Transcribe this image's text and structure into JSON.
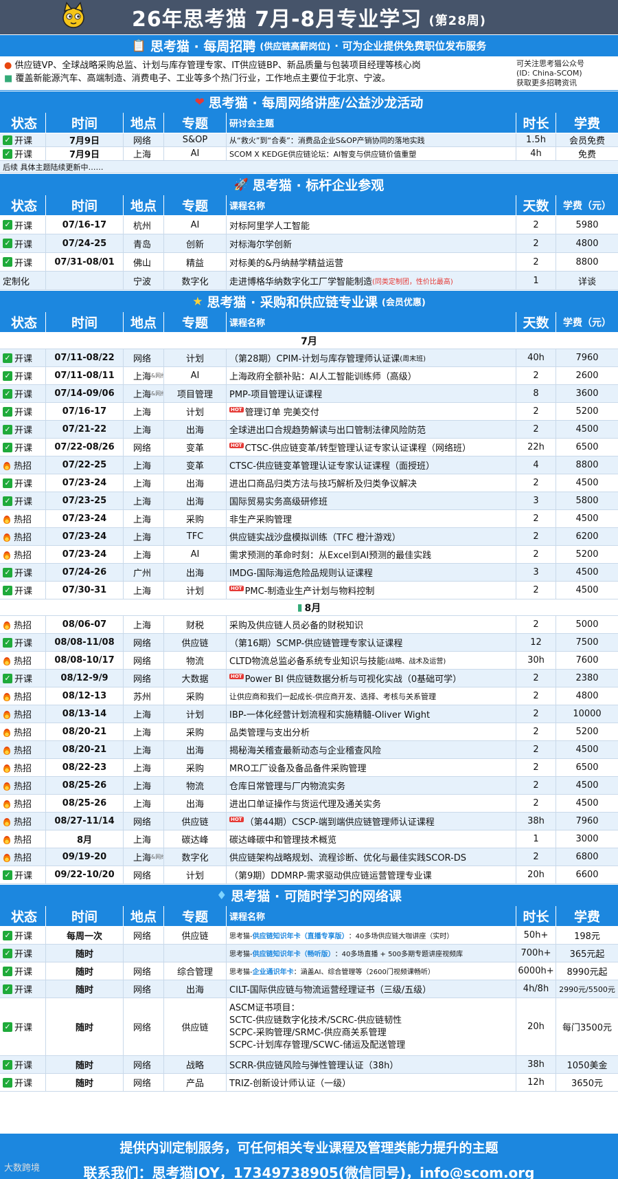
{
  "title": {
    "main": "26年思考猫 7月-8月专业学习",
    "week": "(第28周)"
  },
  "recruit": {
    "heading": "思考猫 · 每周招聘",
    "heading_sub": "(供应链高薪岗位)",
    "heading_tail": "· 可为企业提供免费职位发布服务",
    "line1": "供应链VP、全球战略采购总监、计划与库存管理专家、IT供应链BP、新品质量与包装项目经理等核心岗",
    "line2": "覆盖新能源汽车、高端制造、消费电子、工业等多个热门行业，工作地点主要位于北京、宁波。",
    "side1": "可关注思考猫公众号",
    "side2": "(ID: China-SCOM)",
    "side3": "获取更多招聘资讯"
  },
  "seminar": {
    "heading": "思考猫 · 每周网络讲座/公益沙龙活动",
    "headers": [
      "状态",
      "时间",
      "地点",
      "专题",
      "研讨会主题",
      "时长",
      "学费"
    ],
    "rows": [
      {
        "status": "开课",
        "time": "7月9日",
        "loc": "网络",
        "topic": "S&OP",
        "name": "从“救火”到“合奏”：消费品企业S&OP产销协同的落地实践",
        "dur": "1.5h",
        "fee": "会员免费"
      },
      {
        "status": "开课",
        "time": "7月9日",
        "loc": "上海",
        "topic": "AI",
        "name": "SCOM X KEDGE供应链论坛：AI智变与供应链价值重塑",
        "dur": "4h",
        "fee": "免费"
      }
    ],
    "note": "后续 具体主题陆续更新中……"
  },
  "visits": {
    "heading": "思考猫 · 标杆企业参观",
    "headers": [
      "状态",
      "时间",
      "地点",
      "专题",
      "课程名称",
      "天数",
      "学费（元）"
    ],
    "rows": [
      {
        "status": "开课",
        "time": "07/16-17",
        "loc": "杭州",
        "topic": "AI",
        "name": "对标阿里学人工智能",
        "dur": "2",
        "fee": "5980"
      },
      {
        "status": "开课",
        "time": "07/24-25",
        "loc": "青岛",
        "topic": "创新",
        "name": "对标海尔学创新",
        "dur": "2",
        "fee": "4800"
      },
      {
        "status": "开课",
        "time": "07/31-08/01",
        "loc": "佛山",
        "topic": "精益",
        "name": "对标美的&丹纳赫学精益运营",
        "dur": "2",
        "fee": "8800"
      },
      {
        "status": "定制化",
        "time": "",
        "loc": "宁波",
        "topic": "数字化",
        "name": "走进博格华纳数字化工厂学智能制造",
        "name_note": "(同类定制团，性价比最高)",
        "dur": "1",
        "fee": "详谈"
      }
    ]
  },
  "courses": {
    "heading": "思考猫 · 采购和供应链专业课",
    "heading_sub": "(会员优惠)",
    "headers": [
      "状态",
      "时间",
      "地点",
      "专题",
      "课程名称",
      "天数",
      "学费（元）"
    ],
    "month_jul": "7月",
    "month_aug": "8月",
    "jul": [
      {
        "status": "开课",
        "time": "07/11-08/22",
        "loc": "网络",
        "topic": "计划",
        "name": "（第28期）CPIM-计划与库存管理师认证课",
        "name_note": "(周末班)",
        "dur": "40h",
        "fee": "7960"
      },
      {
        "status": "开课",
        "time": "07/11-08/11",
        "loc": "上海",
        "loc_note": "&网络",
        "topic": "AI",
        "name": "上海政府全额补贴：AI人工智能训练师（高级）",
        "dur": "2",
        "fee": "2600"
      },
      {
        "status": "开课",
        "time": "07/14-09/06",
        "loc": "上海",
        "loc_note": "&网络",
        "topic": "项目管理",
        "name": "PMP-项目管理认证课程",
        "dur": "8",
        "fee": "3600"
      },
      {
        "status": "开课",
        "time": "07/16-17",
        "loc": "上海",
        "topic": "计划",
        "name": "管理订单 完美交付",
        "hot": "HOT",
        "dur": "2",
        "fee": "5200"
      },
      {
        "status": "开课",
        "time": "07/21-22",
        "loc": "上海",
        "topic": "出海",
        "name": "全球进出口合规趋势解读与出口管制法律风险防范",
        "dur": "2",
        "fee": "4500"
      },
      {
        "status": "开课",
        "time": "07/22-08/26",
        "loc": "网络",
        "topic": "变革",
        "name": "CTSC-供应链变革/转型管理认证专家认证课程（网络班）",
        "hot": "HOT",
        "dur": "22h",
        "fee": "6500"
      },
      {
        "status": "热招",
        "time": "07/22-25",
        "loc": "上海",
        "topic": "变革",
        "name": "CTSC-供应链变革管理认证专家认证课程（面授班）",
        "dur": "4",
        "fee": "8800"
      },
      {
        "status": "开课",
        "time": "07/23-24",
        "loc": "上海",
        "topic": "出海",
        "name": "进出口商品归类方法与技巧解析及归类争议解决",
        "dur": "2",
        "fee": "4500"
      },
      {
        "status": "开课",
        "time": "07/23-25",
        "loc": "上海",
        "topic": "出海",
        "name": "国际贸易实务高级研修班",
        "dur": "3",
        "fee": "5800"
      },
      {
        "status": "热招",
        "time": "07/23-24",
        "loc": "上海",
        "topic": "采购",
        "name": "非生产采购管理",
        "dur": "2",
        "fee": "4500"
      },
      {
        "status": "热招",
        "time": "07/23-24",
        "loc": "上海",
        "topic": "TFC",
        "name": "供应链实战沙盘模拟训练（TFC 橙汁游戏）",
        "dur": "2",
        "fee": "6200"
      },
      {
        "status": "热招",
        "time": "07/23-24",
        "loc": "上海",
        "topic": "AI",
        "name": "需求预测的革命时刻：从Excel到AI预测的最佳实践",
        "dur": "2",
        "fee": "5200"
      },
      {
        "status": "开课",
        "time": "07/24-26",
        "loc": "广州",
        "topic": "出海",
        "name": "IMDG-国际海运危险品规则认证课程",
        "dur": "3",
        "fee": "4500"
      },
      {
        "status": "开课",
        "time": "07/30-31",
        "loc": "上海",
        "topic": "计划",
        "name": "PMC-制造业生产计划与物料控制",
        "hot": "HOT",
        "dur": "2",
        "fee": "4500"
      }
    ],
    "aug": [
      {
        "status": "热招",
        "time": "08/06-07",
        "loc": "上海",
        "topic": "财税",
        "name": "采购及供应链人员必备的财税知识",
        "dur": "2",
        "fee": "5000"
      },
      {
        "status": "开课",
        "time": "08/08-11/08",
        "loc": "网络",
        "topic": "供应链",
        "name": "（第16期）SCMP-供应链管理专家认证课程",
        "dur": "12",
        "fee": "7500"
      },
      {
        "status": "热招",
        "time": "08/08-10/17",
        "loc": "网络",
        "topic": "物流",
        "name": "CLTD物流总监必备系统专业知识与技能",
        "name_note": "(战略、战术及运营)",
        "dur": "30h",
        "fee": "7600"
      },
      {
        "status": "开课",
        "time": "08/12-9/9",
        "loc": "网络",
        "topic": "大数据",
        "name": "Power BI 供应链数据分析与可视化实战（0基础可学）",
        "hot": "HOT",
        "dur": "2",
        "fee": "2380"
      },
      {
        "status": "热招",
        "time": "08/12-13",
        "loc": "苏州",
        "topic": "采购",
        "name": "让供应商和我们一起成长-供应商开发、选择、考核与关系管理",
        "small": true,
        "dur": "2",
        "fee": "4800"
      },
      {
        "status": "热招",
        "time": "08/13-14",
        "loc": "上海",
        "topic": "计划",
        "name": "IBP-一体化经营计划流程和实施精髓-Oliver Wight",
        "dur": "2",
        "fee": "10000"
      },
      {
        "status": "热招",
        "time": "08/20-21",
        "loc": "上海",
        "topic": "采购",
        "name": "品类管理与支出分析",
        "dur": "2",
        "fee": "5200"
      },
      {
        "status": "热招",
        "time": "08/20-21",
        "loc": "上海",
        "topic": "出海",
        "name": "揭秘海关稽查最新动态与企业稽查风险",
        "dur": "2",
        "fee": "4500"
      },
      {
        "status": "热招",
        "time": "08/22-23",
        "loc": "上海",
        "topic": "采购",
        "name": "MRO工厂设备及备品备件采购管理",
        "dur": "2",
        "fee": "6500"
      },
      {
        "status": "热招",
        "time": "08/25-26",
        "loc": "上海",
        "topic": "物流",
        "name": "仓库日常管理与厂内物流实务",
        "dur": "2",
        "fee": "4500"
      },
      {
        "status": "热招",
        "time": "08/25-26",
        "loc": "上海",
        "topic": "出海",
        "name": "进出口单证操作与货运代理及通关实务",
        "dur": "2",
        "fee": "4500"
      },
      {
        "status": "热招",
        "time": "08/27-11/14",
        "loc": "网络",
        "topic": "供应链",
        "name": "（第44期）CSCP-端到端供应链管理师认证课程",
        "hot": "HOT",
        "dur": "38h",
        "fee": "7960"
      },
      {
        "status": "热招",
        "time": "8月",
        "loc": "上海",
        "topic": "碳达峰",
        "name": "碳达峰碳中和管理技术概览",
        "dur": "1",
        "fee": "3000"
      },
      {
        "status": "热招",
        "time": "09/19-20",
        "loc": "上海",
        "loc_note": "&网络",
        "topic": "数字化",
        "name": "供应链架构战略规划、流程诊断、优化与最佳实践SCOR-DS",
        "dur": "2",
        "fee": "6800"
      },
      {
        "status": "开课",
        "time": "09/22-10/20",
        "loc": "网络",
        "topic": "计划",
        "name": "（第9期）DDMRP-需求驱动供应链运营管理专业课",
        "dur": "20h",
        "fee": "6600"
      }
    ]
  },
  "online": {
    "heading": "思考猫 · 可随时学习的网络课",
    "headers": [
      "状态",
      "时间",
      "地点",
      "专题",
      "课程名称",
      "时长",
      "学费"
    ],
    "rows": [
      {
        "status": "开课",
        "time": "每周一次",
        "loc": "网络",
        "topic": "供应链",
        "pre": "思考猫-",
        "hl": "供应链知识年卡（直播专享版）",
        "post": "：40多场供应链大咖讲座（实时）",
        "dur": "50h+",
        "fee": "198元"
      },
      {
        "status": "开课",
        "time": "随时",
        "loc": "",
        "topic": "",
        "pre": "思考猫-",
        "hl": "供应链知识年卡（畅听版）",
        "post": "：40多场直播 + 500多期专题讲座视频库",
        "dur": "700h+",
        "fee": "365元起"
      },
      {
        "status": "开课",
        "time": "随时",
        "loc": "网络",
        "topic": "综合管理",
        "pre": "思考猫-",
        "hl": "企业通识年卡",
        "post": "：涵盖AI、综合管理等（2600门视频课畅听）",
        "dur": "6000h+",
        "fee": "8990元起"
      },
      {
        "status": "开课",
        "time": "随时",
        "loc": "网络",
        "topic": "出海",
        "name": "CILT-国际供应链与物流运营经理证书（三级/五级）",
        "dur": "4h/8h",
        "fee": "2990元/5500元"
      },
      {
        "status": "开课",
        "time": "随时",
        "loc": "网络",
        "topic": "供应链",
        "lines": [
          "ASCM证书项目：",
          "SCTC-供应链数字化技术/SCRC-供应链韧性",
          "SCPC-采购管理/SRMC-供应商关系管理",
          "SCPC-计划库存管理/SCWC-储运及配送管理"
        ],
        "dur": "20h",
        "fee": "每门3500元"
      },
      {
        "status": "开课",
        "time": "随时",
        "loc": "网络",
        "topic": "战略",
        "name": "SCRR-供应链风险与弹性管理认证（38h）",
        "dur": "38h",
        "fee": "1050美金"
      },
      {
        "status": "开课",
        "time": "随时",
        "loc": "网络",
        "topic": "产品",
        "name": "TRIZ-创新设计师认证（一级）",
        "dur": "12h",
        "fee": "3650元"
      }
    ]
  },
  "footer": {
    "line1": "提供内训定制服务，可任何相关专业课程及管理类能力提升的主题",
    "line2": "联系我们：思考猫JOY，17349738905(微信同号)，info@scom.org",
    "watermark": "大数跨境"
  },
  "colors": {
    "header_blue": "#1c87df",
    "title_bg": "#46546a",
    "stripe": "#e6f1fb",
    "check_green": "#1faa3a"
  }
}
